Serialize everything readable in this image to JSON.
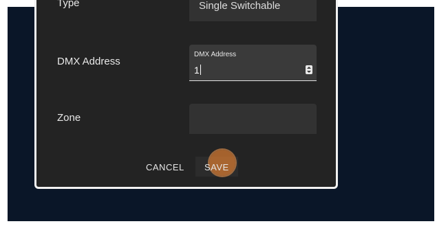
{
  "dialog": {
    "type_row": {
      "label": "Type",
      "value": "Single Switchable"
    },
    "dmx_row": {
      "label": "DMX Address",
      "field_label": "DMX Address",
      "value": "1"
    },
    "zone_row": {
      "label": "Zone",
      "value": ""
    },
    "actions": {
      "cancel_label": "CANCEL",
      "save_label": "SAVE"
    }
  },
  "colors": {
    "backdrop": "#0a1628",
    "dialog_bg": "#232323",
    "field_bg": "#323232",
    "click_indicator": "#d27832"
  }
}
